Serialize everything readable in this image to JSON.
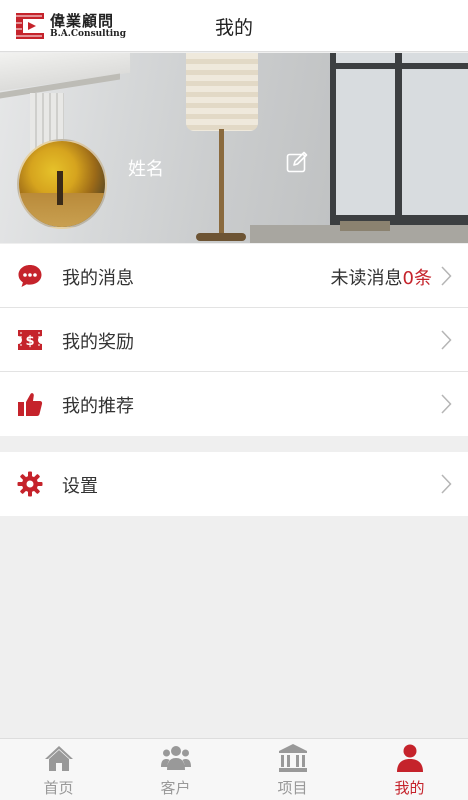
{
  "header": {
    "logo_cn": "偉業顧問",
    "logo_en": "B.A.Consulting",
    "title": "我的"
  },
  "profile": {
    "name": "姓名"
  },
  "menu": {
    "messages_label": "我的消息",
    "messages_unread_text": "未读消息",
    "messages_unread_count": "0条",
    "rewards_label": "我的奖励",
    "recommend_label": "我的推荐",
    "settings_label": "设置"
  },
  "tabbar": {
    "tabs": [
      {
        "label": "首页",
        "icon": "home-icon"
      },
      {
        "label": "客户",
        "icon": "customers-icon"
      },
      {
        "label": "项目",
        "icon": "project-bank-icon"
      },
      {
        "label": "我的",
        "icon": "user-icon",
        "active": true
      }
    ]
  },
  "colors": {
    "accent": "#c5232b",
    "inactive": "#999999",
    "background": "#efefef"
  }
}
